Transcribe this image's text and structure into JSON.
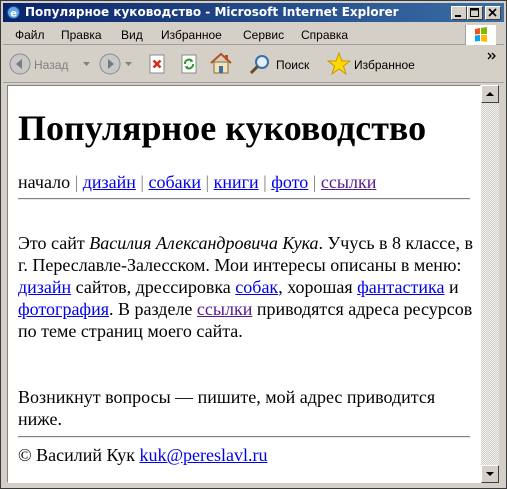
{
  "window": {
    "title": "Популярное куководство - Microsoft Internet Explorer"
  },
  "menu": {
    "file": "Файл",
    "edit": "Правка",
    "view": "Вид",
    "favorites": "Избранное",
    "tools": "Сервис",
    "help": "Справка"
  },
  "toolbar": {
    "back": "Назад",
    "search": "Поиск",
    "favorites": "Избранное"
  },
  "page": {
    "heading": "Популярное куководство",
    "nav": {
      "home": "начало",
      "design": "дизайн",
      "dogs": "собаки",
      "books": "книги",
      "photo": "фото",
      "links": "ссылки",
      "separator": "|"
    },
    "intro": {
      "t1": "Это сайт ",
      "author": "Василия Александровича Кука",
      "t2": ". Учусь в 8 классе, в г. Переславле-Залесском. Мои интересы описаны в меню: ",
      "l_design": "дизайн",
      "t3": " сайтов, дрессировка ",
      "l_dogs": "собак",
      "t4": ", хорошая ",
      "l_fantasy": "фантастика",
      "t5": " и ",
      "l_photo": "фотография",
      "t6": ". В разделе ",
      "l_links": "ссылки",
      "t7": " приводятся адреса ресурсов по теме страниц моего сайта."
    },
    "questions": "Возникнут вопросы — пишите, мой адрес приводится ниже.",
    "footer": {
      "copyright": "© Василий Кук ",
      "email": "kuk@pereslavl.ru"
    }
  },
  "colors": {
    "titlebar_start": "#0a246a",
    "titlebar_end": "#3a6ea5",
    "link": "#0000ee",
    "visited": "#551a8b"
  },
  "icons": [
    "ie-logo-icon",
    "minimize-icon",
    "maximize-icon",
    "close-icon",
    "windows-logo-icon",
    "back-arrow-icon",
    "forward-arrow-icon",
    "stop-icon",
    "refresh-icon",
    "home-icon",
    "search-icon",
    "favorites-star-icon",
    "chevron-more-icon",
    "scroll-up-icon",
    "scroll-down-icon"
  ]
}
